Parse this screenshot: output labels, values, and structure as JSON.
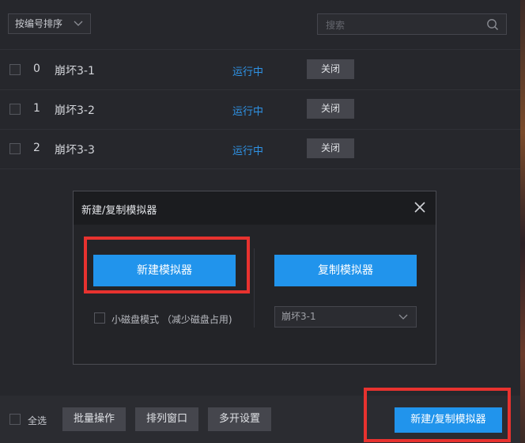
{
  "toolbar": {
    "sort_label": "按编号排序",
    "search_placeholder": "搜索"
  },
  "emulators": [
    {
      "index": "0",
      "name": "崩坏3-1",
      "status": "运行中",
      "action": "关闭"
    },
    {
      "index": "1",
      "name": "崩坏3-2",
      "status": "运行中",
      "action": "关闭"
    },
    {
      "index": "2",
      "name": "崩坏3-3",
      "status": "运行中",
      "action": "关闭"
    }
  ],
  "dialog": {
    "title": "新建/复制模拟器",
    "new_button": "新建模拟器",
    "copy_button": "复制模拟器",
    "small_disk_label": "小磁盘模式 （减少磁盘占用)",
    "copy_source": "崩坏3-1"
  },
  "footer": {
    "select_all": "全选",
    "batch": "批量操作",
    "arrange": "排列窗口",
    "multi_settings": "多开设置",
    "new_copy": "新建/复制模拟器"
  },
  "colors": {
    "accent": "#2194ec",
    "status": "#2f94e8",
    "highlight": "#e8322f",
    "background": "#26272c"
  }
}
